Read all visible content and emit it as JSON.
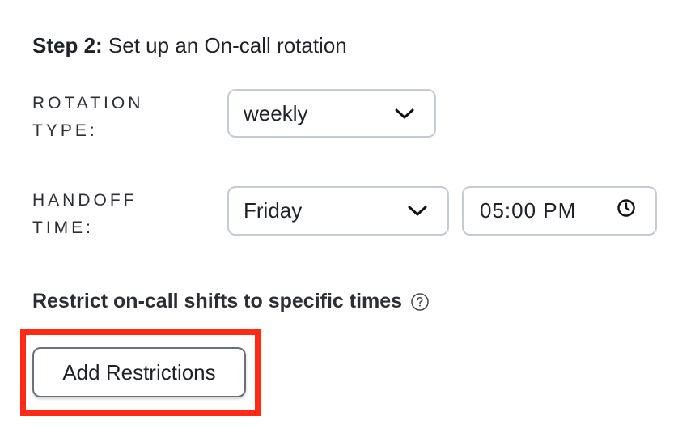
{
  "step": {
    "number_label": "Step 2:",
    "title": "Set up an On-call rotation"
  },
  "rotation_type": {
    "label_line1": "ROTATION",
    "label_line2": "TYPE:",
    "selected": "weekly",
    "icon": "chevron-down-icon"
  },
  "handoff_time": {
    "label_line1": "HANDOFF",
    "label_line2": "TIME:",
    "day_selected": "Friday",
    "day_icon": "chevron-down-icon",
    "time_value": "05:00 PM",
    "time_icon": "clock-icon"
  },
  "restrictions": {
    "label": "Restrict on-call shifts to specific times",
    "help_icon": "help-circle-icon",
    "button_label": "Add Restrictions"
  },
  "colors": {
    "highlight": "#ff2a14",
    "border": "#c5cbd3",
    "text": "#1f2328"
  }
}
